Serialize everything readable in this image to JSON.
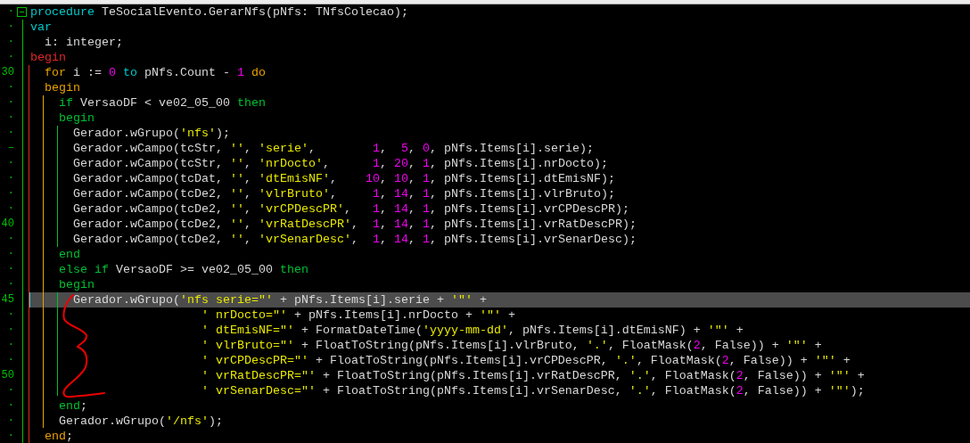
{
  "editor": {
    "lines": [
      {
        "gutter": "·",
        "fold_toggle": true,
        "highlighted": false,
        "tokens": [
          {
            "text": "procedure",
            "kind": "keyword"
          },
          {
            "text": " TeSocialEvento.GerarNfs(pNfs: TNfsColecao);",
            "kind": "plain"
          }
        ]
      },
      {
        "gutter": "·",
        "highlighted": false,
        "tokens": [
          {
            "text": "var",
            "kind": "keyword"
          }
        ]
      },
      {
        "gutter": "·",
        "highlighted": false,
        "tokens": [
          {
            "text": "  i: integer;",
            "kind": "plain"
          }
        ]
      },
      {
        "gutter": "·",
        "highlighted": false,
        "tokens": [
          {
            "text": "begin",
            "kind": "routine_block"
          }
        ]
      },
      {
        "gutter": "30",
        "highlighted": false,
        "tokens": [
          {
            "text": "  for",
            "kind": "loop_block"
          },
          {
            "text": " i := ",
            "kind": "plain"
          },
          {
            "text": "0",
            "kind": "number"
          },
          {
            "text": " to ",
            "kind": "keyword"
          },
          {
            "text": "pNfs.Count - ",
            "kind": "plain"
          },
          {
            "text": "1",
            "kind": "number"
          },
          {
            "text": " do",
            "kind": "loop_block"
          }
        ]
      },
      {
        "gutter": "·",
        "highlighted": false,
        "tokens": [
          {
            "text": "  begin",
            "kind": "loop_block"
          }
        ]
      },
      {
        "gutter": "·",
        "highlighted": false,
        "tokens": [
          {
            "text": "    if",
            "kind": "condition_block"
          },
          {
            "text": " VersaoDF < ve02_05_00 ",
            "kind": "plain"
          },
          {
            "text": "then",
            "kind": "condition_block"
          }
        ]
      },
      {
        "gutter": "·",
        "highlighted": false,
        "tokens": [
          {
            "text": "    begin",
            "kind": "condition_block"
          }
        ]
      },
      {
        "gutter": "·",
        "highlighted": false,
        "tokens": [
          {
            "text": "      Gerador.wGrupo(",
            "kind": "plain"
          },
          {
            "text": "'nfs'",
            "kind": "string"
          },
          {
            "text": ");",
            "kind": "plain"
          }
        ]
      },
      {
        "gutter": "–",
        "highlighted": false,
        "tokens": [
          {
            "text": "      Gerador.wCampo(tcStr, ",
            "kind": "plain"
          },
          {
            "text": "''",
            "kind": "string"
          },
          {
            "text": ", ",
            "kind": "plain"
          },
          {
            "text": "'serie'",
            "kind": "string"
          },
          {
            "text": ",        ",
            "kind": "plain"
          },
          {
            "text": "1",
            "kind": "number"
          },
          {
            "text": ",  ",
            "kind": "plain"
          },
          {
            "text": "5",
            "kind": "number"
          },
          {
            "text": ", ",
            "kind": "plain"
          },
          {
            "text": "0",
            "kind": "number"
          },
          {
            "text": ", pNfs.Items[i].serie);",
            "kind": "plain"
          }
        ]
      },
      {
        "gutter": "·",
        "highlighted": false,
        "tokens": [
          {
            "text": "      Gerador.wCampo(tcStr, ",
            "kind": "plain"
          },
          {
            "text": "''",
            "kind": "string"
          },
          {
            "text": ", ",
            "kind": "plain"
          },
          {
            "text": "'nrDocto'",
            "kind": "string"
          },
          {
            "text": ",      ",
            "kind": "plain"
          },
          {
            "text": "1",
            "kind": "number"
          },
          {
            "text": ", ",
            "kind": "plain"
          },
          {
            "text": "20",
            "kind": "number"
          },
          {
            "text": ", ",
            "kind": "plain"
          },
          {
            "text": "1",
            "kind": "number"
          },
          {
            "text": ", pNfs.Items[i].nrDocto);",
            "kind": "plain"
          }
        ]
      },
      {
        "gutter": "·",
        "highlighted": false,
        "tokens": [
          {
            "text": "      Gerador.wCampo(tcDat, ",
            "kind": "plain"
          },
          {
            "text": "''",
            "kind": "string"
          },
          {
            "text": ", ",
            "kind": "plain"
          },
          {
            "text": "'dtEmisNF'",
            "kind": "string"
          },
          {
            "text": ",    ",
            "kind": "plain"
          },
          {
            "text": "10",
            "kind": "number"
          },
          {
            "text": ", ",
            "kind": "plain"
          },
          {
            "text": "10",
            "kind": "number"
          },
          {
            "text": ", ",
            "kind": "plain"
          },
          {
            "text": "1",
            "kind": "number"
          },
          {
            "text": ", pNfs.Items[i].dtEmisNF);",
            "kind": "plain"
          }
        ]
      },
      {
        "gutter": "·",
        "highlighted": false,
        "tokens": [
          {
            "text": "      Gerador.wCampo(tcDe2, ",
            "kind": "plain"
          },
          {
            "text": "''",
            "kind": "string"
          },
          {
            "text": ", ",
            "kind": "plain"
          },
          {
            "text": "'vlrBruto'",
            "kind": "string"
          },
          {
            "text": ",     ",
            "kind": "plain"
          },
          {
            "text": "1",
            "kind": "number"
          },
          {
            "text": ", ",
            "kind": "plain"
          },
          {
            "text": "14",
            "kind": "number"
          },
          {
            "text": ", ",
            "kind": "plain"
          },
          {
            "text": "1",
            "kind": "number"
          },
          {
            "text": ", pNfs.Items[i].vlrBruto);",
            "kind": "plain"
          }
        ]
      },
      {
        "gutter": "·",
        "highlighted": false,
        "tokens": [
          {
            "text": "      Gerador.wCampo(tcDe2, ",
            "kind": "plain"
          },
          {
            "text": "''",
            "kind": "string"
          },
          {
            "text": ", ",
            "kind": "plain"
          },
          {
            "text": "'vrCPDescPR'",
            "kind": "string"
          },
          {
            "text": ",   ",
            "kind": "plain"
          },
          {
            "text": "1",
            "kind": "number"
          },
          {
            "text": ", ",
            "kind": "plain"
          },
          {
            "text": "14",
            "kind": "number"
          },
          {
            "text": ", ",
            "kind": "plain"
          },
          {
            "text": "1",
            "kind": "number"
          },
          {
            "text": ", pNfs.Items[i].vrCPDescPR);",
            "kind": "plain"
          }
        ]
      },
      {
        "gutter": "40",
        "highlighted": false,
        "tokens": [
          {
            "text": "      Gerador.wCampo(tcDe2, ",
            "kind": "plain"
          },
          {
            "text": "''",
            "kind": "string"
          },
          {
            "text": ", ",
            "kind": "plain"
          },
          {
            "text": "'vrRatDescPR'",
            "kind": "string"
          },
          {
            "text": ",  ",
            "kind": "plain"
          },
          {
            "text": "1",
            "kind": "number"
          },
          {
            "text": ", ",
            "kind": "plain"
          },
          {
            "text": "14",
            "kind": "number"
          },
          {
            "text": ", ",
            "kind": "plain"
          },
          {
            "text": "1",
            "kind": "number"
          },
          {
            "text": ", pNfs.Items[i].vrRatDescPR);",
            "kind": "plain"
          }
        ]
      },
      {
        "gutter": "·",
        "highlighted": false,
        "tokens": [
          {
            "text": "      Gerador.wCampo(tcDe2, ",
            "kind": "plain"
          },
          {
            "text": "''",
            "kind": "string"
          },
          {
            "text": ", ",
            "kind": "plain"
          },
          {
            "text": "'vrSenarDesc'",
            "kind": "string"
          },
          {
            "text": ",  ",
            "kind": "plain"
          },
          {
            "text": "1",
            "kind": "number"
          },
          {
            "text": ", ",
            "kind": "plain"
          },
          {
            "text": "14",
            "kind": "number"
          },
          {
            "text": ", ",
            "kind": "plain"
          },
          {
            "text": "1",
            "kind": "number"
          },
          {
            "text": ", pNfs.Items[i].vrSenarDesc);",
            "kind": "plain"
          }
        ]
      },
      {
        "gutter": "·",
        "highlighted": false,
        "tokens": [
          {
            "text": "    end",
            "kind": "condition_block"
          }
        ]
      },
      {
        "gutter": "·",
        "highlighted": false,
        "tokens": [
          {
            "text": "    else if",
            "kind": "condition_block"
          },
          {
            "text": " VersaoDF >= ve02_05_00 ",
            "kind": "plain"
          },
          {
            "text": "then",
            "kind": "condition_block"
          }
        ]
      },
      {
        "gutter": "·",
        "highlighted": false,
        "tokens": [
          {
            "text": "    begin",
            "kind": "condition_block"
          }
        ]
      },
      {
        "gutter": "45",
        "highlighted": true,
        "tokens": [
          {
            "text": "      Gerador.wGrupo(",
            "kind": "plain"
          },
          {
            "text": "'nfs serie=\"'",
            "kind": "string"
          },
          {
            "text": " + pNfs.Items[i].serie + ",
            "kind": "plain"
          },
          {
            "text": "'\"'",
            "kind": "string"
          },
          {
            "text": " +",
            "kind": "plain"
          }
        ]
      },
      {
        "gutter": "·",
        "highlighted": false,
        "tokens": [
          {
            "text": "                        ' nrDocto=\"'",
            "kind": "string"
          },
          {
            "text": " + pNfs.Items[i].nrDocto + ",
            "kind": "plain"
          },
          {
            "text": "'\"'",
            "kind": "string"
          },
          {
            "text": " +",
            "kind": "plain"
          }
        ]
      },
      {
        "gutter": "·",
        "highlighted": false,
        "tokens": [
          {
            "text": "                        ' dtEmisNF=\"'",
            "kind": "string"
          },
          {
            "text": " + FormatDateTime(",
            "kind": "plain"
          },
          {
            "text": "'yyyy-mm-dd'",
            "kind": "string"
          },
          {
            "text": ", pNfs.Items[i].dtEmisNF) + ",
            "kind": "plain"
          },
          {
            "text": "'\"'",
            "kind": "string"
          },
          {
            "text": " +",
            "kind": "plain"
          }
        ]
      },
      {
        "gutter": "·",
        "highlighted": false,
        "tokens": [
          {
            "text": "                        ' vlrBruto=\"'",
            "kind": "string"
          },
          {
            "text": " + FloatToString(pNfs.Items[i].vlrBruto, ",
            "kind": "plain"
          },
          {
            "text": "'.'",
            "kind": "string"
          },
          {
            "text": ", FloatMask(",
            "kind": "plain"
          },
          {
            "text": "2",
            "kind": "number"
          },
          {
            "text": ", False)) + ",
            "kind": "plain"
          },
          {
            "text": "'\"'",
            "kind": "string"
          },
          {
            "text": " +",
            "kind": "plain"
          }
        ]
      },
      {
        "gutter": "·",
        "highlighted": false,
        "tokens": [
          {
            "text": "                        ' vrCPDescPR=\"'",
            "kind": "string"
          },
          {
            "text": " + FloatToString(pNfs.Items[i].vrCPDescPR, ",
            "kind": "plain"
          },
          {
            "text": "'.'",
            "kind": "string"
          },
          {
            "text": ", FloatMask(",
            "kind": "plain"
          },
          {
            "text": "2",
            "kind": "number"
          },
          {
            "text": ", False)) + ",
            "kind": "plain"
          },
          {
            "text": "'\"'",
            "kind": "string"
          },
          {
            "text": " +",
            "kind": "plain"
          }
        ]
      },
      {
        "gutter": "50",
        "highlighted": false,
        "tokens": [
          {
            "text": "                        ' vrRatDescPR=\"'",
            "kind": "string"
          },
          {
            "text": " + FloatToString(pNfs.Items[i].vrRatDescPR, ",
            "kind": "plain"
          },
          {
            "text": "'.'",
            "kind": "string"
          },
          {
            "text": ", FloatMask(",
            "kind": "plain"
          },
          {
            "text": "2",
            "kind": "number"
          },
          {
            "text": ", False)) + ",
            "kind": "plain"
          },
          {
            "text": "'\"'",
            "kind": "string"
          },
          {
            "text": " +",
            "kind": "plain"
          }
        ]
      },
      {
        "gutter": "·",
        "highlighted": false,
        "tokens": [
          {
            "text": "                        ' vrSenarDesc=\"'",
            "kind": "string"
          },
          {
            "text": " + FloatToString(pNfs.Items[i].vrSenarDesc, ",
            "kind": "plain"
          },
          {
            "text": "'.'",
            "kind": "string"
          },
          {
            "text": ", FloatMask(",
            "kind": "plain"
          },
          {
            "text": "2",
            "kind": "number"
          },
          {
            "text": ", False)) + ",
            "kind": "plain"
          },
          {
            "text": "'\"'",
            "kind": "string"
          },
          {
            "text": ");",
            "kind": "plain"
          }
        ]
      },
      {
        "gutter": "·",
        "highlighted": false,
        "tokens": [
          {
            "text": "    end",
            "kind": "condition_block"
          },
          {
            "text": ";",
            "kind": "plain"
          }
        ]
      },
      {
        "gutter": "·",
        "highlighted": false,
        "tokens": [
          {
            "text": "    Gerador.wGrupo(",
            "kind": "plain"
          },
          {
            "text": "'/nfs'",
            "kind": "string"
          },
          {
            "text": ");",
            "kind": "plain"
          }
        ]
      },
      {
        "gutter": "·",
        "highlighted": false,
        "tokens": [
          {
            "text": "  end",
            "kind": "loop_block"
          },
          {
            "text": ";",
            "kind": "plain"
          }
        ]
      }
    ]
  }
}
